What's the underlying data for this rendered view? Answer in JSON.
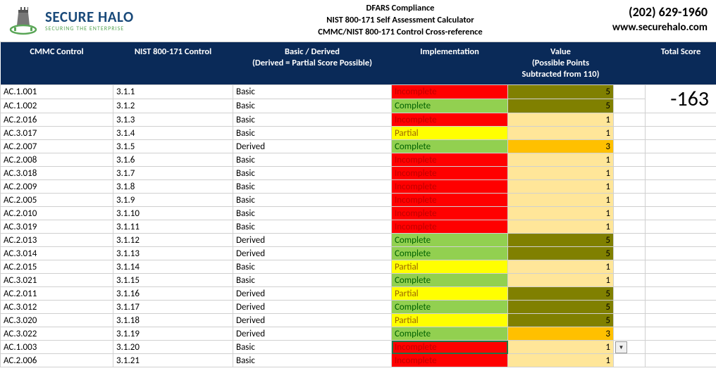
{
  "header": {
    "logo_main": "SECURE HALO",
    "logo_sub": "SECURING THE ENTERPRISE",
    "title_line1": "DFARS Compliance",
    "title_line2": "NIST 800-171 Self Assessment Calculator",
    "title_line3": "CMMC/NIST 800-171 Control Cross-reference",
    "phone": "(202) 629-1960",
    "site": "www.securehalo.com"
  },
  "columns": {
    "c1": "CMMC Control",
    "c2": "NIST 800-171 Control",
    "c3_line1": "Basic / Derived",
    "c3_line2": "(Derived = Partial Score Possible)",
    "c4": "Implementation",
    "c5_line1": "Value",
    "c5_line2": "(Possible Points",
    "c5_line3": "Subtracted from 110)",
    "c7": "Total Score"
  },
  "total_score": "-163",
  "rows": [
    {
      "cmmc": "AC.1.001",
      "nist": "3.1.1",
      "type": "Basic",
      "impl": "Incomplete",
      "val": "5",
      "valClass": "olive"
    },
    {
      "cmmc": "AC.1.002",
      "nist": "3.1.2",
      "type": "Basic",
      "impl": "Complete",
      "val": "5",
      "valClass": "olive"
    },
    {
      "cmmc": "AC.2.016",
      "nist": "3.1.3",
      "type": "Basic",
      "impl": "Incomplete",
      "val": "1",
      "valClass": "beige"
    },
    {
      "cmmc": "AC.3.017",
      "nist": "3.1.4",
      "type": "Basic",
      "impl": "Partial",
      "val": "1",
      "valClass": "beige"
    },
    {
      "cmmc": "AC.2.007",
      "nist": "3.1.5",
      "type": "Derived",
      "impl": "Complete",
      "val": "3",
      "valClass": "orange"
    },
    {
      "cmmc": "AC.2.008",
      "nist": "3.1.6",
      "type": "Basic",
      "impl": "Incomplete",
      "val": "1",
      "valClass": "beige"
    },
    {
      "cmmc": "AC.3.018",
      "nist": "3.1.7",
      "type": "Basic",
      "impl": "Incomplete",
      "val": "1",
      "valClass": "beige"
    },
    {
      "cmmc": "AC.2.009",
      "nist": "3.1.8",
      "type": "Basic",
      "impl": "Incomplete",
      "val": "1",
      "valClass": "beige"
    },
    {
      "cmmc": "AC.2.005",
      "nist": "3.1.9",
      "type": "Basic",
      "impl": "Incomplete",
      "val": "1",
      "valClass": "beige"
    },
    {
      "cmmc": "AC.2.010",
      "nist": "3.1.10",
      "type": "Basic",
      "impl": "Incomplete",
      "val": "1",
      "valClass": "beige"
    },
    {
      "cmmc": "AC.3.019",
      "nist": "3.1.11",
      "type": "Basic",
      "impl": "Incomplete",
      "val": "1",
      "valClass": "beige"
    },
    {
      "cmmc": "AC.2.013",
      "nist": "3.1.12",
      "type": "Derived",
      "impl": "Complete",
      "val": "5",
      "valClass": "olive"
    },
    {
      "cmmc": "AC.3.014",
      "nist": "3.1.13",
      "type": "Derived",
      "impl": "Complete",
      "val": "5",
      "valClass": "olive"
    },
    {
      "cmmc": "AC.2.015",
      "nist": "3.1.14",
      "type": "Basic",
      "impl": "Partial",
      "val": "1",
      "valClass": "beige"
    },
    {
      "cmmc": "AC.3.021",
      "nist": "3.1.15",
      "type": "Basic",
      "impl": "Complete",
      "val": "1",
      "valClass": "beige"
    },
    {
      "cmmc": "AC.2.011",
      "nist": "3.1.16",
      "type": "Derived",
      "impl": "Partial",
      "val": "5",
      "valClass": "olive"
    },
    {
      "cmmc": "AC.3.012",
      "nist": "3.1.17",
      "type": "Derived",
      "impl": "Complete",
      "val": "5",
      "valClass": "olive"
    },
    {
      "cmmc": "AC.3.020",
      "nist": "3.1.18",
      "type": "Derived",
      "impl": "Partial",
      "val": "5",
      "valClass": "olive"
    },
    {
      "cmmc": "AC.3.022",
      "nist": "3.1.19",
      "type": "Derived",
      "impl": "Complete",
      "val": "3",
      "valClass": "orange"
    },
    {
      "cmmc": "AC.1.003",
      "nist": "3.1.20",
      "type": "Basic",
      "impl": "Incomplete",
      "val": "1",
      "valClass": "beige",
      "selected": true
    },
    {
      "cmmc": "AC.2.006",
      "nist": "3.1.21",
      "type": "Basic",
      "impl": "Incomplete",
      "val": "1",
      "valClass": "beige"
    }
  ]
}
